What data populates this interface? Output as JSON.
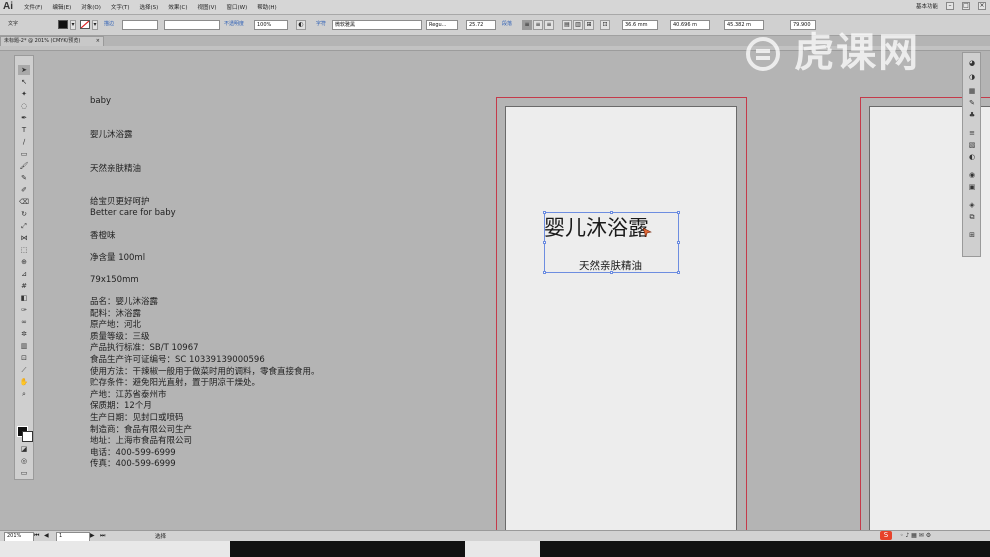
{
  "app": {
    "logo": "Ai",
    "menus": [
      "文件(F)",
      "编辑(E)",
      "对象(O)",
      "文字(T)",
      "选择(S)",
      "效果(C)",
      "视图(V)",
      "窗口(W)",
      "帮助(H)"
    ],
    "workspace": "基本功能"
  },
  "control_bar": {
    "tool_name": "文字",
    "stroke_label": "描边",
    "opacity_label": "不透明度",
    "opacity_value": "100%",
    "char_label": "字符",
    "font_family": "微软雅黑",
    "font_style": "Regu...",
    "font_size": "25.72",
    "para_label": "段落",
    "x_value": "36.6 mm",
    "y_value": "40.696 m",
    "w_value": "45.382 m",
    "h_value": "79.900"
  },
  "document_tab": {
    "title": "未标题-2* @ 201% (CMYK/预览)"
  },
  "canvas": {
    "texts": [
      {
        "text": "baby"
      },
      {
        "text": "婴儿沐浴露"
      },
      {
        "text": "天然亲肤精油"
      },
      {
        "text": "给宝贝更好呵护"
      },
      {
        "text": "Better care for baby"
      },
      {
        "text": "香橙味"
      },
      {
        "text": "净含量 100ml"
      },
      {
        "text": "79x150mm"
      }
    ],
    "spec_lines": [
      "品名：婴儿沐浴露",
      "配料：沐浴露",
      "原产地：河北",
      "质量等级：三级",
      "产品执行标准：SB/T 10967",
      "食品生产许可证编号：SC 10339139000596",
      "使用方法：干辣椒一般用于做菜时用的调料，零食直接食用。",
      "贮存条件：避免阳光直射，置于阴凉干燥处。",
      "产地：江苏省泰州市",
      "保质期：12个月",
      "生产日期：见封口或喷码",
      "制造商：食品有限公司生产",
      "地址：上海市食品有限公司",
      "电话：400-599-6999",
      "传真：400-599-6999"
    ],
    "artboard_title": "婴儿沐浴露",
    "artboard_subtitle": "天然亲肤精油"
  },
  "watermark": "虎课网",
  "status_bar": {
    "zoom": "201%",
    "artboard_number": "1",
    "tool_status": "选择"
  },
  "colors": {
    "bleed_line": "#c43a4a",
    "selection": "#6d8de0",
    "canvas_bg": "#b4b4b4",
    "artboard": "#ededed"
  }
}
